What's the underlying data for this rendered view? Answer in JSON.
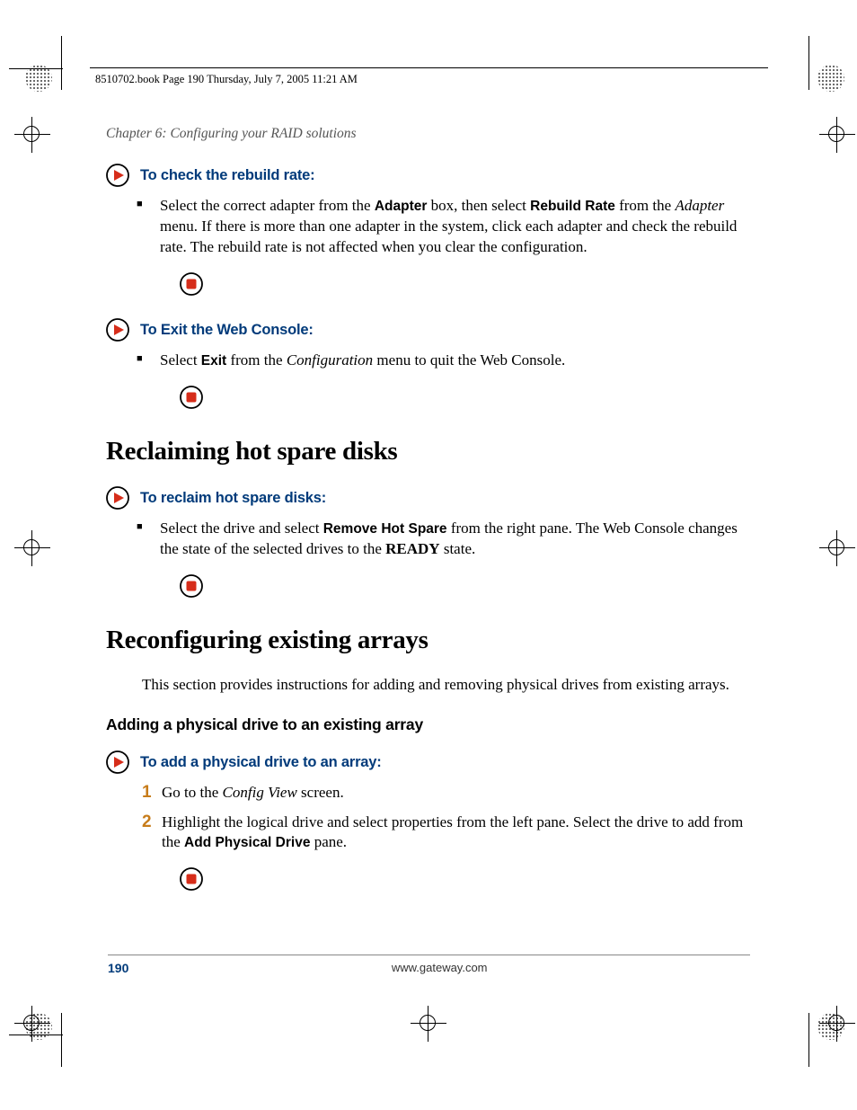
{
  "meta": {
    "runhead": "8510702.book  Page 190  Thursday, July 7, 2005  11:21 AM"
  },
  "chapter": "Chapter 6: Configuring your RAID solutions",
  "task1": {
    "title": "To check the rebuild rate:"
  },
  "p1": {
    "a": "Select the correct adapter from the ",
    "b": "Adapter",
    "c": " box, then select ",
    "d": "Rebuild Rate",
    "e": " from the ",
    "f": "Adapter",
    "g": " menu. If there is more than one adapter in the system, click each adapter and check the rebuild rate. The rebuild rate is not affected when you clear the configuration."
  },
  "task2": {
    "title": "To Exit the Web Console:"
  },
  "p2": {
    "a": "Select ",
    "b": "Exit",
    "c": " from the ",
    "d": "Configuration",
    "e": " menu to quit the Web Console."
  },
  "h1a": "Reclaiming hot spare disks",
  "task3": {
    "title": "To reclaim hot spare disks:"
  },
  "p3": {
    "a": "Select the drive and select ",
    "b": "Remove Hot Spare",
    "c": " from the right pane. The Web Console changes the state of the selected drives to the ",
    "d": "READY",
    "e": " state."
  },
  "h1b": "Reconfiguring existing arrays",
  "p4": "This section provides instructions for adding and removing physical drives from existing arrays.",
  "h2a": "Adding a physical drive to an existing array",
  "task4": {
    "title": "To add a physical drive to an array:"
  },
  "step1": {
    "n": "1",
    "a": "Go to the ",
    "b": "Config View",
    "c": " screen."
  },
  "step2": {
    "n": "2",
    "a": "Highlight the logical drive and select properties from the left pane. Select the drive to add from the ",
    "b": "Add Physical Drive",
    "c": " pane."
  },
  "footer": {
    "page": "190",
    "site": "www.gateway.com"
  }
}
